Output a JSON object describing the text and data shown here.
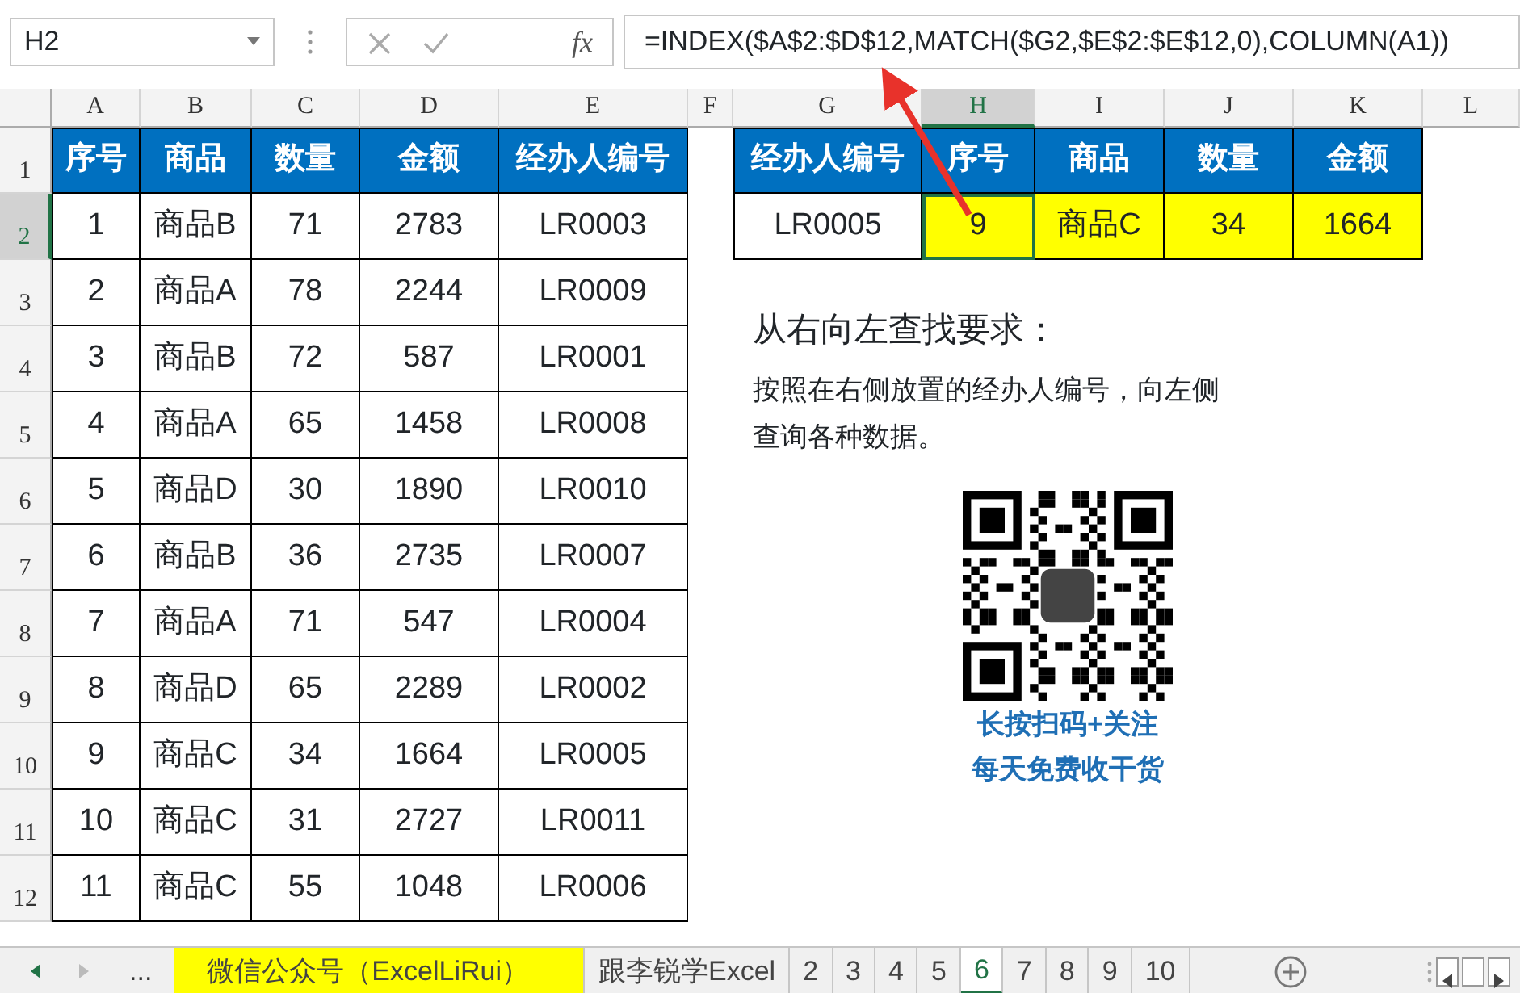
{
  "formula_bar": {
    "name_box": "H2",
    "function_label": "fx",
    "formula": "=INDEX($A$2:$D$12,MATCH($G2,$E$2:$E$12,0),COLUMN(A1))"
  },
  "columns": [
    {
      "label": "A",
      "selected": false
    },
    {
      "label": "B",
      "selected": false
    },
    {
      "label": "C",
      "selected": false
    },
    {
      "label": "D",
      "selected": false
    },
    {
      "label": "E",
      "selected": false
    },
    {
      "label": "F",
      "selected": false
    },
    {
      "label": "G",
      "selected": false
    },
    {
      "label": "H",
      "selected": true
    },
    {
      "label": "I",
      "selected": false
    },
    {
      "label": "J",
      "selected": false
    },
    {
      "label": "K",
      "selected": false
    },
    {
      "label": "L",
      "selected": false
    }
  ],
  "rows": [
    {
      "label": "1",
      "selected": false
    },
    {
      "label": "2",
      "selected": true
    },
    {
      "label": "3",
      "selected": false
    },
    {
      "label": "4",
      "selected": false
    },
    {
      "label": "5",
      "selected": false
    },
    {
      "label": "6",
      "selected": false
    },
    {
      "label": "7",
      "selected": false
    },
    {
      "label": "8",
      "selected": false
    },
    {
      "label": "9",
      "selected": false
    },
    {
      "label": "10",
      "selected": false
    },
    {
      "label": "11",
      "selected": false
    },
    {
      "label": "12",
      "selected": false
    }
  ],
  "source_table": {
    "headers": [
      "序号",
      "商品",
      "数量",
      "金额",
      "经办人编号"
    ],
    "rows": [
      [
        "1",
        "商品B",
        "71",
        "2783",
        "LR0003"
      ],
      [
        "2",
        "商品A",
        "78",
        "2244",
        "LR0009"
      ],
      [
        "3",
        "商品B",
        "72",
        "587",
        "LR0001"
      ],
      [
        "4",
        "商品A",
        "65",
        "1458",
        "LR0008"
      ],
      [
        "5",
        "商品D",
        "30",
        "1890",
        "LR0010"
      ],
      [
        "6",
        "商品B",
        "36",
        "2735",
        "LR0007"
      ],
      [
        "7",
        "商品A",
        "71",
        "547",
        "LR0004"
      ],
      [
        "8",
        "商品D",
        "65",
        "2289",
        "LR0002"
      ],
      [
        "9",
        "商品C",
        "34",
        "1664",
        "LR0005"
      ],
      [
        "10",
        "商品C",
        "31",
        "2727",
        "LR0011"
      ],
      [
        "11",
        "商品C",
        "55",
        "1048",
        "LR0006"
      ]
    ]
  },
  "lookup_table": {
    "headers": [
      "经办人编号",
      "序号",
      "商品",
      "数量",
      "金额"
    ],
    "cells": [
      {
        "text": "LR0005",
        "highlighted": false,
        "selected": false
      },
      {
        "text": "9",
        "highlighted": true,
        "selected": true
      },
      {
        "text": "商品C",
        "highlighted": true,
        "selected": false
      },
      {
        "text": "34",
        "highlighted": true,
        "selected": false
      },
      {
        "text": "1664",
        "highlighted": true,
        "selected": false
      }
    ]
  },
  "note": {
    "title": "从右向左查找要求：",
    "body": "按照在右侧放置的经办人编号，向左侧查询各种数据。"
  },
  "qr": {
    "captions": [
      "长按扫码+关注",
      "每天免费收干货"
    ]
  },
  "sheet_tabs": {
    "more": "...",
    "tabs": [
      {
        "label": "微信公众号（ExcelLiRui）",
        "selected": false,
        "color": "#ffff00"
      },
      {
        "label": "跟李锐学Excel",
        "selected": false
      },
      {
        "label": "2",
        "selected": false
      },
      {
        "label": "3",
        "selected": false
      },
      {
        "label": "4",
        "selected": false
      },
      {
        "label": "5",
        "selected": false
      },
      {
        "label": "6",
        "selected": true
      },
      {
        "label": "7",
        "selected": false
      },
      {
        "label": "8",
        "selected": false
      },
      {
        "label": "9",
        "selected": false
      },
      {
        "label": "10",
        "selected": false
      }
    ]
  }
}
